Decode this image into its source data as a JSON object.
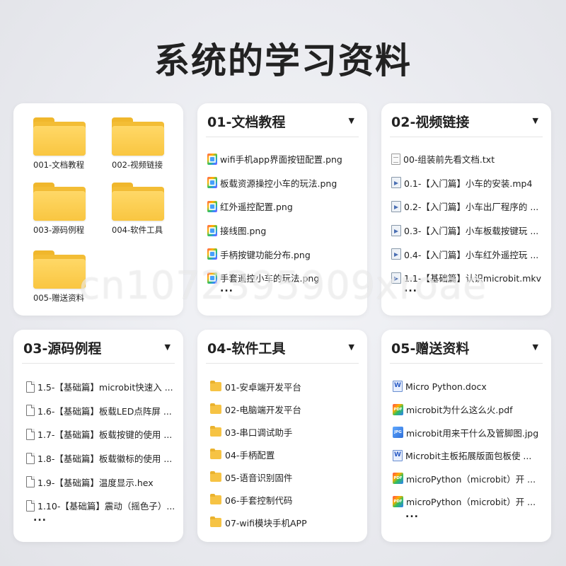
{
  "title": "系统的学习资料",
  "watermark": "cn1072395909xroae",
  "folders_card": {
    "items": [
      {
        "label": "001-文档教程"
      },
      {
        "label": "002-视频链接"
      },
      {
        "label": "003-源码例程"
      },
      {
        "label": "004-软件工具"
      },
      {
        "label": "005-赠送资料"
      }
    ]
  },
  "doc_card": {
    "title": "01-文档教程",
    "items": [
      {
        "icon": "image",
        "text": "wifi手机app界面按钮配置.png"
      },
      {
        "icon": "image",
        "text": "板载资源操控小车的玩法.png"
      },
      {
        "icon": "image",
        "text": "红外遥控配置.png"
      },
      {
        "icon": "image",
        "text": "接线图.png"
      },
      {
        "icon": "image",
        "text": "手柄按键功能分布.png"
      },
      {
        "icon": "image",
        "text": "手套遥控小车的玩法.png"
      }
    ],
    "more": "..."
  },
  "video_card": {
    "title": "02-视频链接",
    "items": [
      {
        "icon": "text",
        "text": "00-组装前先看文档.txt"
      },
      {
        "icon": "video",
        "text": "0.1-【入门篇】小车的安装.mp4"
      },
      {
        "icon": "video",
        "text": "0.2-【入门篇】小车出厂程序的 ..."
      },
      {
        "icon": "video",
        "text": "0.3-【入门篇】小车板载按键玩 ..."
      },
      {
        "icon": "video",
        "text": "0.4-【入门篇】小车红外遥控玩 ..."
      },
      {
        "icon": "video",
        "text": "1.1-【基础篇】认识microbit.mkv"
      }
    ],
    "more": "..."
  },
  "source_card": {
    "title": "03-源码例程",
    "items": [
      {
        "icon": "file",
        "text": "1.5-【基础篇】microbit快速入 ..."
      },
      {
        "icon": "file",
        "text": "1.6-【基础篇】板载LED点阵屏 ..."
      },
      {
        "icon": "file",
        "text": "1.7-【基础篇】板载按键的使用 ..."
      },
      {
        "icon": "file",
        "text": "1.8-【基础篇】板载徽标的使用 ..."
      },
      {
        "icon": "file",
        "text": "1.9-【基础篇】温度显示.hex"
      },
      {
        "icon": "file",
        "text": "1.10-【基础篇】震动（摇色子）..."
      }
    ],
    "more": "..."
  },
  "tools_card": {
    "title": "04-软件工具",
    "items": [
      {
        "icon": "folder",
        "text": "01-安卓端开发平台"
      },
      {
        "icon": "folder",
        "text": "02-电脑端开发平台"
      },
      {
        "icon": "folder",
        "text": "03-串口调试助手"
      },
      {
        "icon": "folder",
        "text": "04-手柄配置"
      },
      {
        "icon": "folder",
        "text": "05-语音识别固件"
      },
      {
        "icon": "folder",
        "text": "06-手套控制代码"
      },
      {
        "icon": "folder",
        "text": "07-wifi模块手机APP"
      }
    ]
  },
  "gift_card": {
    "title": "05-赠送资料",
    "items": [
      {
        "icon": "doc",
        "text": "Micro Python.docx"
      },
      {
        "icon": "pdf",
        "text": "microbit为什么这么火.pdf"
      },
      {
        "icon": "jpg",
        "text": "microbit用来干什么及管脚图.jpg"
      },
      {
        "icon": "doc",
        "text": "Microbit主板拓展版面包板使 ..."
      },
      {
        "icon": "pdf",
        "text": "microPython（microbit）开 ..."
      },
      {
        "icon": "pdf",
        "text": "microPython（microbit）开 ..."
      }
    ],
    "more": "..."
  }
}
